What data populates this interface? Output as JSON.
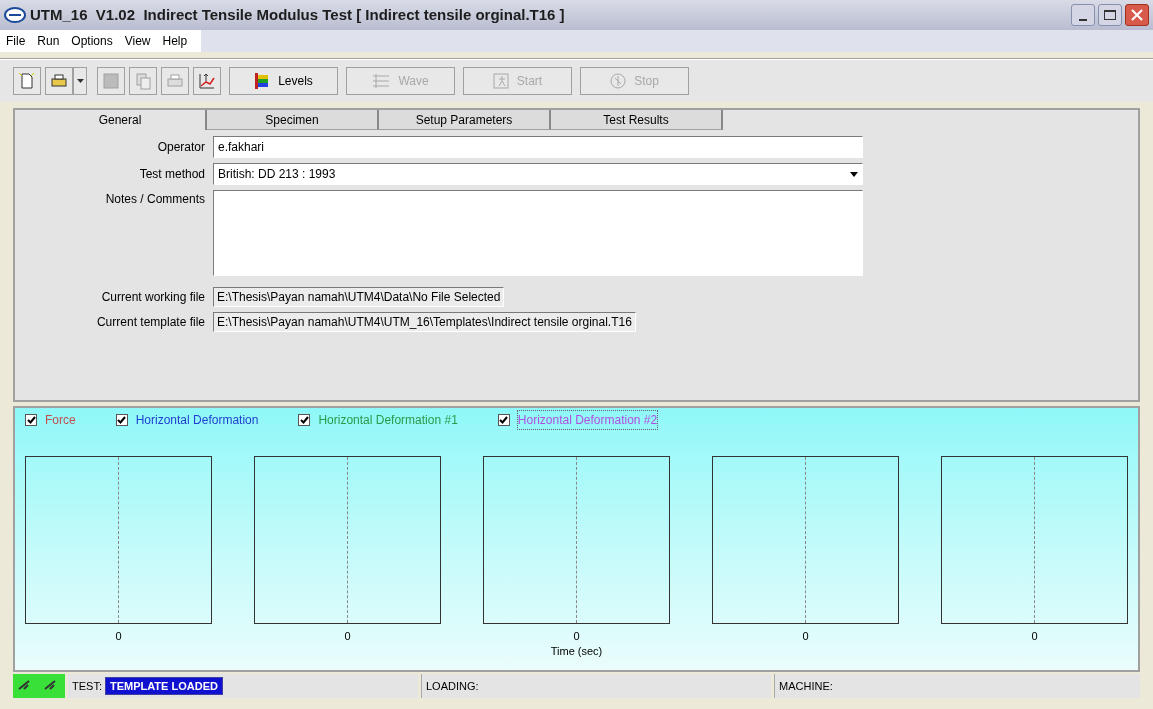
{
  "window": {
    "title": "UTM_16  V1.02  Indirect Tensile Modulus Test [ Indirect tensile orginal.T16 ]"
  },
  "menu": [
    "File",
    "Run",
    "Options",
    "View",
    "Help"
  ],
  "toolbar": [
    {
      "kind": "icon",
      "disabled": false
    },
    {
      "kind": "icon",
      "disabled": false
    },
    {
      "kind": "dropdown",
      "disabled": false
    },
    {
      "kind": "icon",
      "disabled": true
    },
    {
      "kind": "icon",
      "disabled": true
    },
    {
      "kind": "icon",
      "disabled": true
    },
    {
      "kind": "icon",
      "disabled": false
    },
    {
      "kind": "text",
      "label": "Levels",
      "disabled": false
    },
    {
      "kind": "text",
      "label": "Wave",
      "disabled": true
    },
    {
      "kind": "text",
      "label": "Start",
      "disabled": true
    },
    {
      "kind": "text",
      "label": "Stop",
      "disabled": true
    }
  ],
  "tabs": [
    {
      "label": "General",
      "selected": true
    },
    {
      "label": "Specimen",
      "selected": false
    },
    {
      "label": "Setup Parameters",
      "selected": false
    },
    {
      "label": "Test Results",
      "selected": false
    }
  ],
  "form": {
    "operator": {
      "label": "Operator",
      "value": "e.fakhari"
    },
    "test_method": {
      "label": "Test method",
      "value": "British: DD 213 : 1993"
    },
    "notes": {
      "label": "Notes / Comments"
    },
    "working_file": {
      "label": "Current working file",
      "value": "E:\\Thesis\\Payan namah\\UTM4\\Data\\No File Selected"
    },
    "template_file": {
      "label": "Current template file",
      "value": "E:\\Thesis\\Payan namah\\UTM4\\UTM_16\\Templates\\Indirect tensile orginal.T16"
    }
  },
  "legend": [
    {
      "label": "Force",
      "checked": true,
      "color": "#c0504d",
      "selected": false
    },
    {
      "label": "Horizontal Deformation",
      "checked": true,
      "color": "#1f3fd0",
      "selected": false
    },
    {
      "label": "Horizontal Deformation #1",
      "checked": true,
      "color": "#2a9a4a",
      "selected": false
    },
    {
      "label": "Horizontal Deformation #2",
      "checked": true,
      "color": "#b050e0",
      "selected": true
    }
  ],
  "plots": [
    {
      "tick": "0"
    },
    {
      "tick": "0"
    },
    {
      "tick": "0"
    },
    {
      "tick": "0"
    },
    {
      "tick": "0"
    }
  ],
  "x_axis_label": "Time (sec)",
  "status_bar": {
    "test_label": "TEST:",
    "test_value": "TEMPLATE LOADED",
    "loading": "LOADING:",
    "machine": "MACHINE:"
  }
}
